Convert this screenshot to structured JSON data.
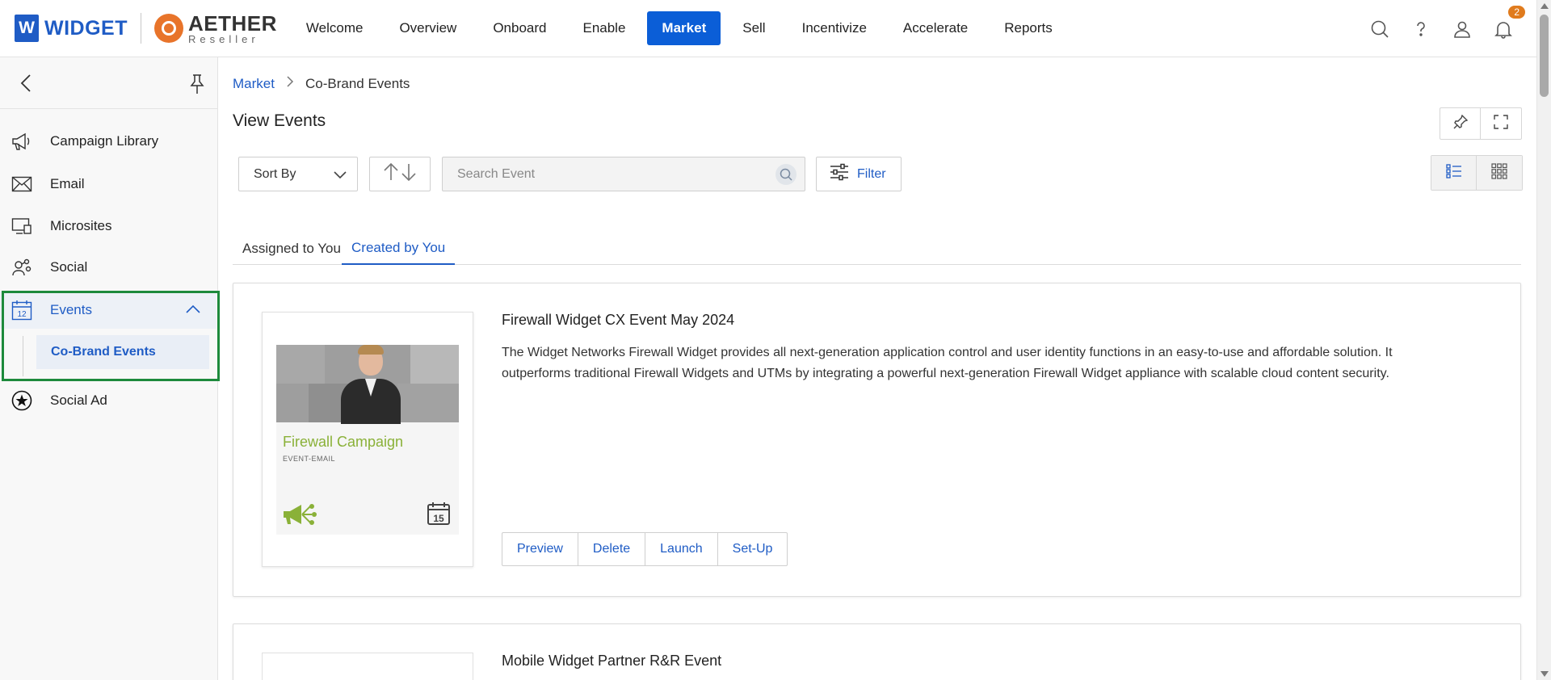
{
  "brand": {
    "w_letter": "W",
    "w_name": "WIDGET",
    "aether_name": "AETHER",
    "aether_sub": "Reseller"
  },
  "nav": {
    "items": [
      "Welcome",
      "Overview",
      "Onboard",
      "Enable",
      "Market",
      "Sell",
      "Incentivize",
      "Accelerate",
      "Reports"
    ],
    "active": "Market"
  },
  "notifications": {
    "count": "2"
  },
  "sidebar": {
    "items": {
      "campaign_library": "Campaign Library",
      "email": "Email",
      "microsites": "Microsites",
      "social": "Social",
      "events": "Events",
      "co_brand_events": "Co-Brand Events",
      "social_ad": "Social Ad"
    },
    "events_calendar_day": "12"
  },
  "breadcrumb": {
    "parent": "Market",
    "current": "Co-Brand Events"
  },
  "page": {
    "title": "View Events"
  },
  "toolbar": {
    "sort_label": "Sort By",
    "search_placeholder": "Search Event",
    "filter_label": "Filter"
  },
  "tabs": {
    "assigned": "Assigned to You",
    "created": "Created by You",
    "active": "Created by You"
  },
  "events": [
    {
      "title": "Firewall Widget CX Event May 2024",
      "description": "The Widget Networks Firewall Widget provides all next-generation application control and user identity functions in an easy-to-use and affordable solution. It outperforms traditional Firewall Widgets and UTMs by integrating a powerful next-generation Firewall Widget appliance with scalable cloud content security.",
      "thumb_title": "Firewall Campaign",
      "thumb_sub": "EVENT-EMAIL",
      "thumb_cal_day": "15",
      "actions": {
        "preview": "Preview",
        "delete": "Delete",
        "launch": "Launch",
        "setup": "Set-Up"
      }
    },
    {
      "title": "Mobile Widget Partner R&R Event"
    }
  ],
  "colors": {
    "accent": "#1f5cc5",
    "active_nav": "#0b5ed7",
    "highlight_border": "#1d8a3c",
    "badge": "#e07b1d",
    "thumb_green": "#8ab138"
  }
}
